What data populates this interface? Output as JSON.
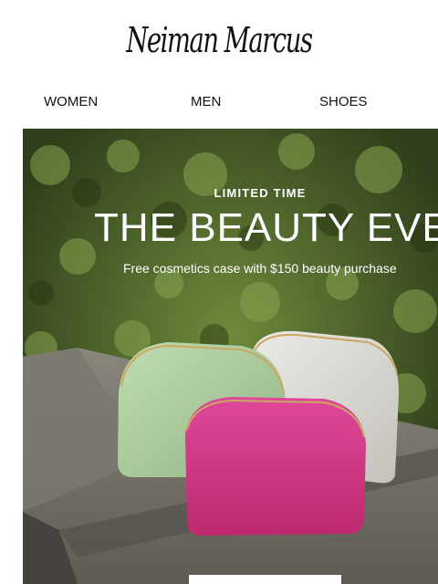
{
  "brand": {
    "name": "Neiman Marcus"
  },
  "nav": {
    "items": [
      "WOMEN",
      "MEN",
      "SHOES"
    ]
  },
  "hero": {
    "kicker": "LIMITED TIME",
    "title": "THE BEAUTY EVENT",
    "subtitle": "Free cosmetics case with $150 beauty purchase",
    "cta_label": ""
  },
  "colors": {
    "foliage": "#3b4a24",
    "stone": "#6d6a62",
    "case_green": "#a9cc9d",
    "case_grey": "#dcdad3",
    "case_pink": "#d1307d"
  }
}
